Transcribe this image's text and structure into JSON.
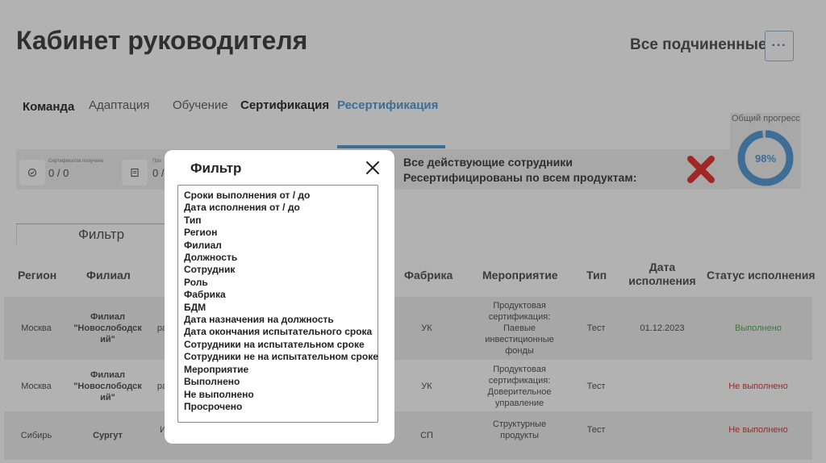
{
  "header": {
    "title": "Кабинет руководителя",
    "subordinates_label": "Все подчиненные",
    "more_label": "···"
  },
  "tabs": [
    {
      "label": "Команда"
    },
    {
      "label": "Адаптация"
    },
    {
      "label": "Обучение"
    },
    {
      "label": "Сертификация"
    },
    {
      "label": "Ресертификация"
    }
  ],
  "stats": {
    "cert_received_label": "Сертификатов получено",
    "cert_received_value": "0 / 0",
    "second_label": "Про",
    "second_value": "0 /",
    "resert_message": "Все действующие сотрудники Ресертифицированы по всем продуктам:"
  },
  "progress": {
    "label": "Общий прогресс",
    "value_text": "98%",
    "value": 0.98,
    "color": "#5a9cd6"
  },
  "filter_button_label": "Фильтр",
  "table": {
    "headers": {
      "region": "Регион",
      "branch": "Филиал",
      "factory": "Фабрика",
      "event": "Мероприятие",
      "type": "Тип",
      "date": "Дата исполнения",
      "status": "Статус исполнения"
    },
    "rows": [
      {
        "region": "Москва",
        "branch": "Филиал \"Новослободск ий\"",
        "employee_fragment": "ра",
        "factory": "УК",
        "event": "Продуктовая сертификация: Паевые инвестиционные фонды",
        "type": "Тест",
        "date": "01.12.2023",
        "status": "Выполнено"
      },
      {
        "region": "Москва",
        "branch": "Филиал \"Новослободск ий\"",
        "employee_fragment": "ра",
        "factory": "УК",
        "event": "Продуктовая сертификация: Доверительное управление",
        "type": "Тест",
        "date": "",
        "status": "Не выполнено"
      },
      {
        "region": "Сибирь",
        "branch": "Сургут",
        "employee_fragment": "И",
        "factory": "СП",
        "event": "Структурные продукты",
        "type": "Тест",
        "date": "",
        "status": "Не выполнено"
      }
    ]
  },
  "modal": {
    "title": "Фильтр",
    "items": [
      "Сроки выполнения от / до",
      "Дата исполнения от / до",
      "Тип",
      "Регион",
      "Филиал",
      "Должность",
      "Сотрудник",
      "Роль",
      "Фабрика",
      "БДМ",
      "Дата назначения на должность",
      "Дата окончания испытательного срока",
      "Сотрудники на испытательном сроке",
      "Сотрудники не на испытательном сроке",
      "Мероприятие",
      "Выполнено",
      "Не выполнено",
      "Просрочено"
    ]
  },
  "colors": {
    "accent": "#5a9cd6",
    "done": "#4caf50",
    "fail": "#e53935",
    "x_mark": "#e53935"
  }
}
